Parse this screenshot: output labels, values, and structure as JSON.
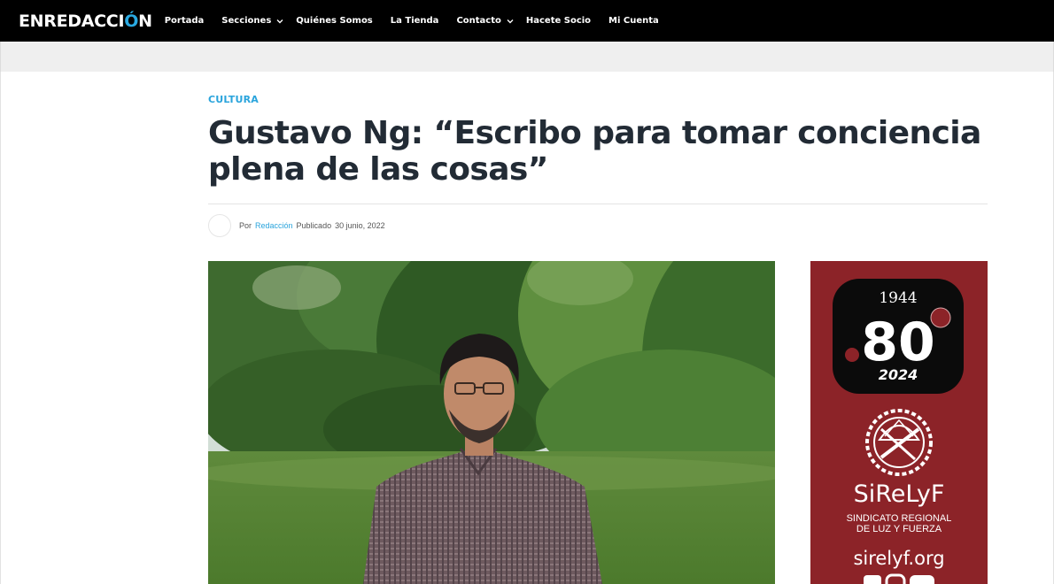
{
  "header": {
    "logo_text_1": "ENREDACCI",
    "logo_text_2": "Ó",
    "logo_text_3": "N",
    "nav": [
      {
        "label": "Portada",
        "has_dropdown": false
      },
      {
        "label": "Secciones",
        "has_dropdown": true
      },
      {
        "label": "Quiénes Somos",
        "has_dropdown": false
      },
      {
        "label": "La Tienda",
        "has_dropdown": false
      },
      {
        "label": "Contacto",
        "has_dropdown": true
      },
      {
        "label": "Hacete Socio",
        "has_dropdown": false
      },
      {
        "label": "Mi Cuenta",
        "has_dropdown": false
      }
    ]
  },
  "article": {
    "category": "CULTURA",
    "title": "Gustavo Ng: “Escribo para tomar conciencia plena de las cosas”",
    "meta": {
      "by_label": "Por",
      "author": "Redacción",
      "published_label": "Publicado",
      "date": "30 junio, 2022"
    }
  },
  "ad": {
    "year_start": "1944",
    "anniversary": "80",
    "year_end": "2024",
    "brand": "SiReLyF",
    "subtitle_line1": "SINDICATO REGIONAL",
    "subtitle_line2": "DE LUZ Y FUERZA",
    "url": "sirelyf.org"
  },
  "colors": {
    "accent": "#2aa4dc",
    "nav_bg": "#000000",
    "title": "#222b35",
    "ad_bg": "#8c2328"
  }
}
